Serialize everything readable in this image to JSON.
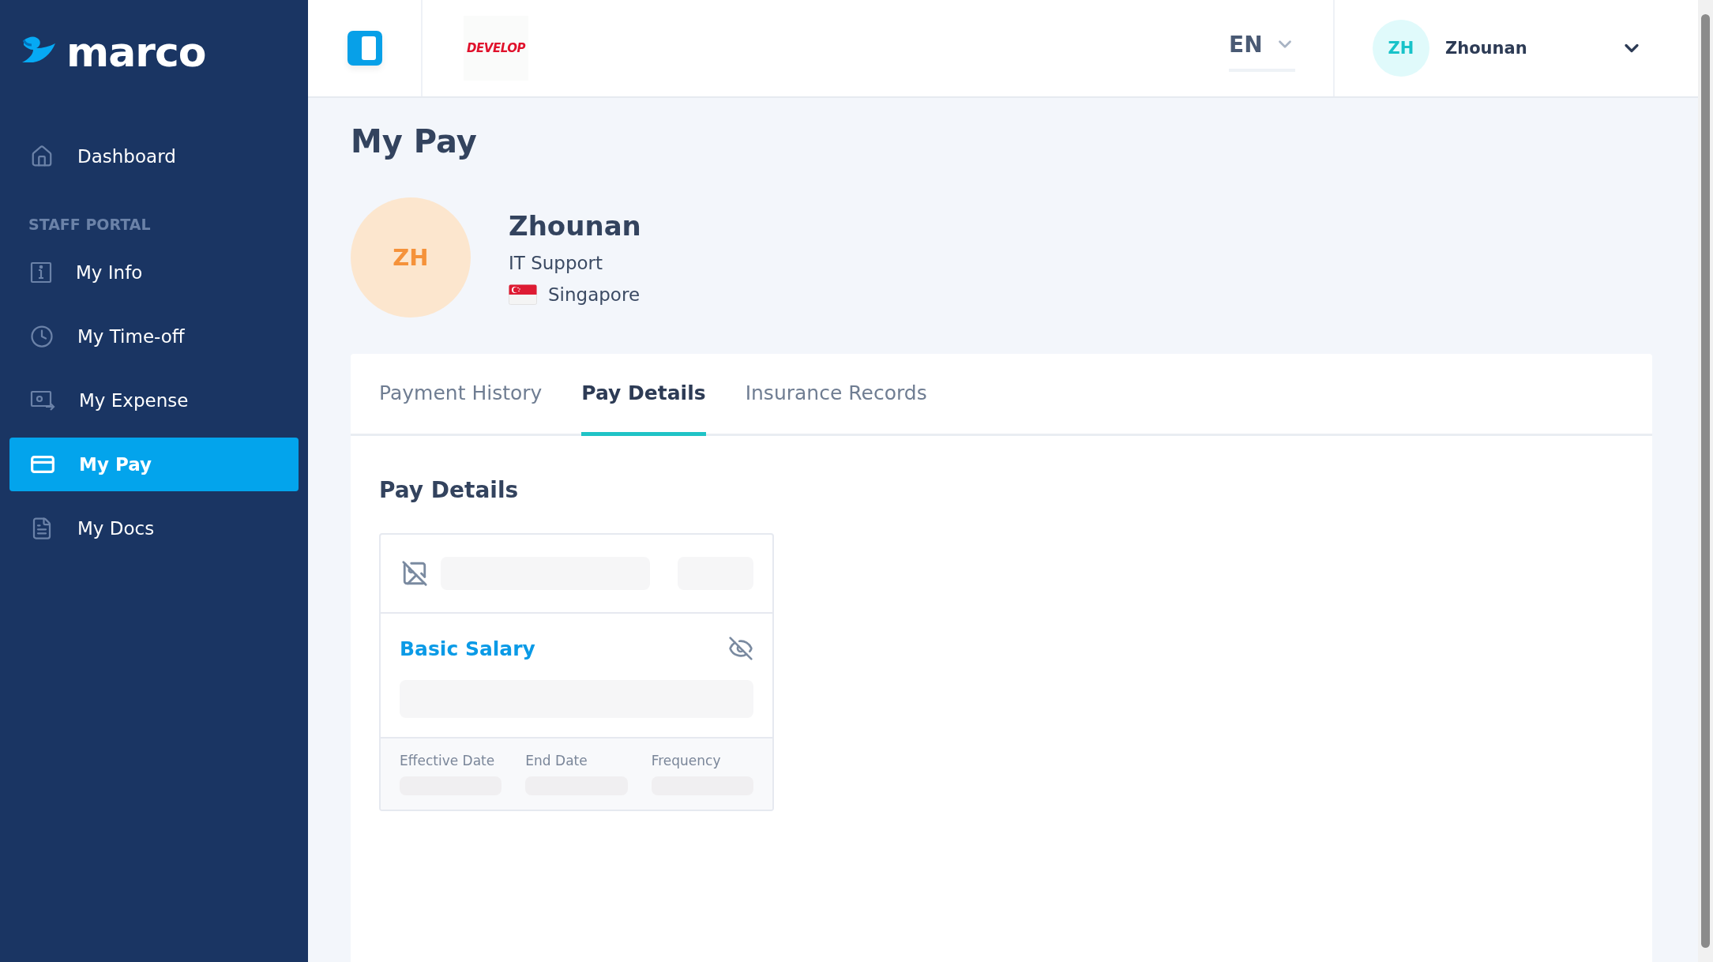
{
  "brand": "marco",
  "sidebar": {
    "top_items": [
      {
        "label": "Dashboard",
        "selected": false
      }
    ],
    "section": {
      "title": "STAFF PORTAL",
      "items": [
        {
          "label": "My Info",
          "selected": false
        },
        {
          "label": "My Time-off",
          "selected": false
        },
        {
          "label": "My Expense",
          "selected": false
        },
        {
          "label": "My Pay",
          "selected": true
        },
        {
          "label": "My Docs",
          "selected": false
        }
      ]
    }
  },
  "header": {
    "env_badge": "DEVELOP",
    "language": "EN",
    "user": {
      "initials": "ZH",
      "name": "Zhounan"
    }
  },
  "page": {
    "title": "My Pay",
    "profile": {
      "initials": "ZH",
      "name": "Zhounan",
      "role": "IT Support",
      "country": "Singapore"
    },
    "tabs": [
      {
        "label": "Payment History",
        "selected": false
      },
      {
        "label": "Pay Details",
        "selected": true
      },
      {
        "label": "Insurance Records",
        "selected": false
      }
    ],
    "section_title": "Pay Details",
    "pay_card": {
      "title": "Basic Salary",
      "fields": [
        "Effective Date",
        "End Date",
        "Frequency"
      ]
    }
  }
}
